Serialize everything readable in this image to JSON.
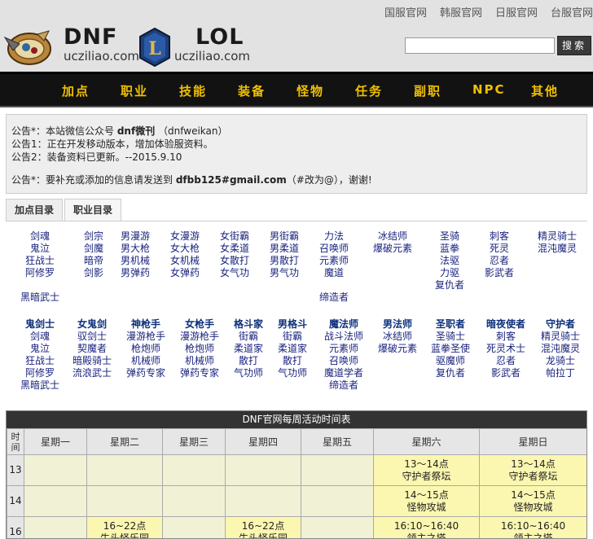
{
  "header": {
    "top_links": [
      "国服官网",
      "韩服官网",
      "日服官网",
      "台服官网"
    ],
    "dnf": {
      "title": "DNF",
      "domain": "ucziliao.com"
    },
    "lol": {
      "title": "LOL",
      "domain": "ucziliao.com"
    },
    "search": {
      "placeholder": "",
      "button": "搜索"
    }
  },
  "nav": [
    "加点",
    "职业",
    "技能",
    "装备",
    "怪物",
    "任务",
    "副职",
    "NPC",
    "其他"
  ],
  "notice": {
    "lines": [
      {
        "label": "公告*：",
        "pre": "本站微信公众号 ",
        "bold": "dnf微刊",
        "post": " （dnfweikan）"
      },
      {
        "label": "公告1：",
        "pre": "正在开发移动版本，增加体验服资料。",
        "bold": "",
        "post": ""
      },
      {
        "label": "公告2：",
        "pre": "装备资料已更新。--2015.9.10",
        "bold": "",
        "post": ""
      },
      {
        "label": "公告*：",
        "pre": "要补充或添加的信息请发送到 ",
        "bold": "dfbb125#gmail.com",
        "post": "（#改为@），谢谢!"
      }
    ]
  },
  "tabs": [
    "加点目录",
    "职业目录"
  ],
  "class_list_a": [
    [
      "剑魂",
      "鬼泣",
      "狂战士",
      "阿修罗",
      "",
      "黑暗武士"
    ],
    [
      "剑宗",
      "剑魔",
      "暗帝",
      "剑影"
    ],
    [
      "男漫游",
      "男大枪",
      "男机械",
      "男弹药"
    ],
    [
      "女漫游",
      "女大枪",
      "女机械",
      "女弹药"
    ],
    [
      "女街霸",
      "女柔道",
      "女散打",
      "女气功"
    ],
    [
      "男街霸",
      "男柔道",
      "男散打",
      "男气功"
    ],
    [
      "力法",
      "召唤师",
      "元素师",
      "魔道",
      "",
      "缔造者"
    ],
    [
      "冰结师",
      "爆破元素"
    ],
    [
      "圣骑",
      "蓝拳",
      "法驱",
      "力驱",
      "复仇者"
    ],
    [
      "刺客",
      "死灵",
      "忍者",
      "影武者"
    ],
    [
      "精灵骑士",
      "混沌魔灵"
    ]
  ],
  "class_list_b": [
    {
      "head": "鬼剑士",
      "items": [
        "剑魂",
        "鬼泣",
        "狂战士",
        "阿修罗",
        "黑暗武士"
      ]
    },
    {
      "head": "女鬼剑",
      "items": [
        "驭剑士",
        "契魔者",
        "暗殿骑士",
        "流浪武士"
      ]
    },
    {
      "head": "神枪手",
      "items": [
        "漫游枪手",
        "枪炮师",
        "机械师",
        "弹药专家"
      ]
    },
    {
      "head": "女枪手",
      "items": [
        "漫游枪手",
        "枪炮师",
        "机械师",
        "弹药专家"
      ]
    },
    {
      "head": "格斗家",
      "items": [
        "街霸",
        "柔道家",
        "散打",
        "气功师"
      ]
    },
    {
      "head": "男格斗",
      "items": [
        "街霸",
        "柔道家",
        "散打",
        "气功师"
      ]
    },
    {
      "head": "魔法师",
      "items": [
        "战斗法师",
        "元素师",
        "召唤师",
        "魔道学者",
        "缔造者"
      ]
    },
    {
      "head": "男法师",
      "items": [
        "冰结师",
        "爆破元素"
      ]
    },
    {
      "head": "圣职者",
      "items": [
        "圣骑士",
        "蓝拳圣使",
        "驱魔师",
        "复仇者"
      ]
    },
    {
      "head": "暗夜使者",
      "items": [
        "刺客",
        "死灵术士",
        "忍者",
        "影武者"
      ]
    },
    {
      "head": "守护者",
      "items": [
        "精灵骑士",
        "混沌魔灵",
        "龙骑士",
        "帕拉丁"
      ]
    }
  ],
  "schedule": {
    "caption": "DNF官网每周活动时间表",
    "hour_header": "时间",
    "days": [
      "星期一",
      "星期二",
      "星期三",
      "星期四",
      "星期五",
      "星期六",
      "星期日"
    ],
    "rows": [
      {
        "hour": "13",
        "cells": [
          "",
          "",
          "",
          "",
          "",
          "13～14点\n守护者祭坛",
          "13～14点\n守护者祭坛"
        ]
      },
      {
        "hour": "14",
        "cells": [
          "",
          "",
          "",
          "",
          "",
          "14～15点\n怪物攻城",
          "14～15点\n怪物攻城"
        ]
      },
      {
        "hour": "16",
        "cells": [
          "",
          "16~22点\n牛头怪乐园",
          "",
          "16~22点\n牛头怪乐园",
          "",
          "16:10~16:40\n领主之塔",
          "16:10~16:40\n领主之塔"
        ]
      }
    ]
  }
}
